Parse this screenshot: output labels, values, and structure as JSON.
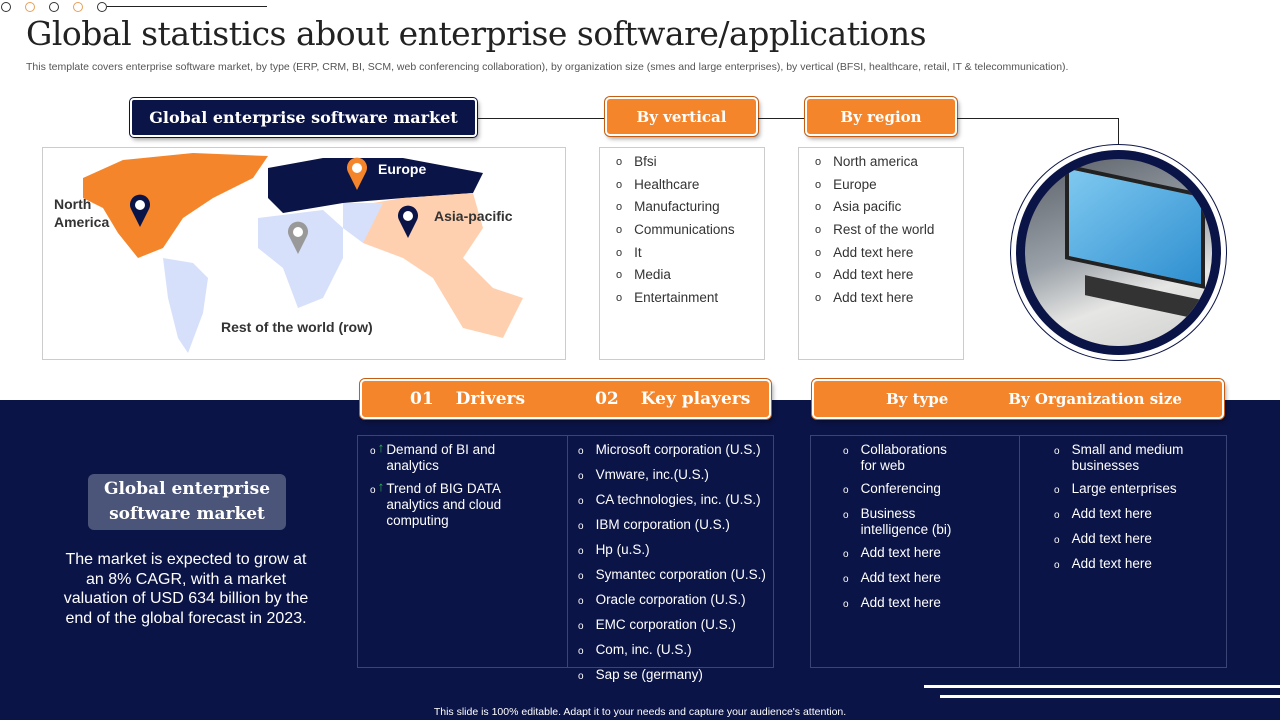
{
  "title": "Global statistics about enterprise software/applications",
  "subtitle": "This template covers enterprise software market, by type (ERP,  CRM,  BI,  SCM,  web conferencing collaboration), by organization size (smes and large enterprises), by vertical (BFSI, healthcare, retail, IT & telecommunication).",
  "market_header": "Global enterprise software market",
  "map": {
    "north_america": "North America",
    "europe": "Europe",
    "asia_pacific": "Asia-pacific",
    "row": "Rest of the world (row)"
  },
  "vertical": {
    "label": "By vertical",
    "items": [
      "Bfsi",
      "Healthcare",
      "Manufacturing",
      "Communications",
      "It",
      "Media",
      "Entertainment"
    ]
  },
  "region": {
    "label": "By region",
    "items": [
      "North america",
      "Europe",
      "Asia pacific",
      "Rest of the world",
      "Add text here",
      "Add text here",
      "Add text here"
    ]
  },
  "drivers": {
    "num": "01",
    "label": "Drivers",
    "items": [
      "Demand of BI and analytics",
      "Trend of BIG DATA analytics and cloud computing"
    ]
  },
  "players": {
    "num": "02",
    "label": "Key players",
    "items": [
      "Microsoft corporation (U.S.)",
      "Vmware, inc.(U.S.)",
      "CA technologies, inc. (U.S.)",
      "IBM corporation (U.S.)",
      "Hp (u.S.)",
      "Symantec corporation (U.S.)",
      "Oracle corporation (U.S.)",
      "EMC corporation (U.S.)",
      "Com, inc. (U.S.)",
      "Sap se (germany)"
    ]
  },
  "by_type": {
    "label": "By type",
    "items": [
      "Collaborations for web",
      "Conferencing",
      "Business intelligence (bi)",
      "Add text here",
      "Add text here",
      "Add text here"
    ]
  },
  "by_org": {
    "label": "By Organization size",
    "items": [
      "Small and medium businesses",
      "Large enterprises",
      "Add text here",
      "Add text here",
      "Add text here"
    ]
  },
  "summary": {
    "title": "Global enterprise software market",
    "text": "The market is expected to grow at an 8% CAGR, with a market valuation of USD 634 billion by the end of the global forecast in 2023."
  },
  "footer": "This slide is 100% editable. Adapt it to your needs and capture your audience's attention.",
  "colors": {
    "navy": "#0b1446",
    "orange": "#f5852b"
  }
}
